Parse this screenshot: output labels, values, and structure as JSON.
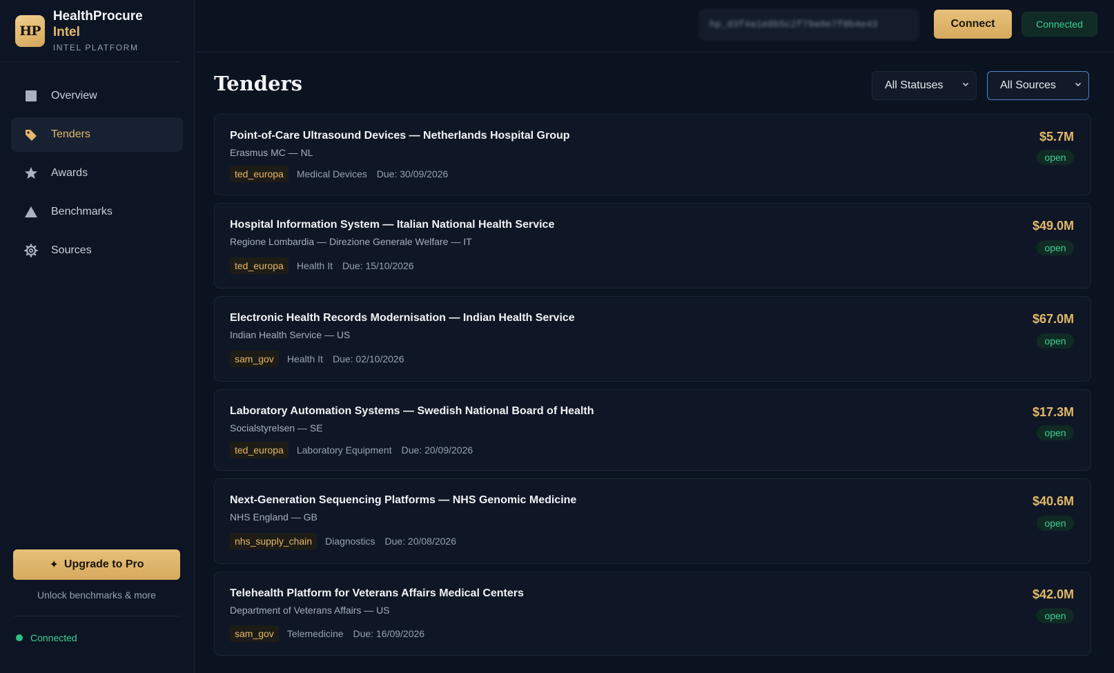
{
  "brand": {
    "logo_text": "HP",
    "name_main": "HealthProcure",
    "name_accent": "Intel",
    "subtitle": "INTEL PLATFORM"
  },
  "sidebar": {
    "items": [
      {
        "label": "Overview",
        "icon": "square-icon",
        "active": false
      },
      {
        "label": "Tenders",
        "icon": "tag-icon",
        "active": true
      },
      {
        "label": "Awards",
        "icon": "star-icon",
        "active": false
      },
      {
        "label": "Benchmarks",
        "icon": "triangle-icon",
        "active": false
      },
      {
        "label": "Sources",
        "icon": "gear-icon",
        "active": false
      }
    ],
    "upgrade_label": "Upgrade to Pro",
    "upgrade_note": "Unlock benchmarks & more",
    "status_text": "Connected"
  },
  "topbar": {
    "api_key_value": "hp_d3f4a1e8b5c2f79a0e7f0b4e43",
    "connect_label": "Connect",
    "connected_label": "Connected"
  },
  "main": {
    "title": "Tenders",
    "status_filter": "All Statuses",
    "source_filter": "All Sources"
  },
  "colors": {
    "accent": "#e3b869",
    "success": "#3fcf95",
    "background": "#0b1220",
    "select_focus": "#4f86c6"
  },
  "tenders": [
    {
      "title": "Point-of-Care Ultrasound Devices — Netherlands Hospital Group",
      "org": "Erasmus MC — NL",
      "source": "ted_europa",
      "category": "Medical Devices",
      "due": "Due: 30/09/2026",
      "value": "$5.7M",
      "status": "open"
    },
    {
      "title": "Hospital Information System — Italian National Health Service",
      "org": "Regione Lombardia — Direzione Generale Welfare — IT",
      "source": "ted_europa",
      "category": "Health It",
      "due": "Due: 15/10/2026",
      "value": "$49.0M",
      "status": "open"
    },
    {
      "title": "Electronic Health Records Modernisation — Indian Health Service",
      "org": "Indian Health Service — US",
      "source": "sam_gov",
      "category": "Health It",
      "due": "Due: 02/10/2026",
      "value": "$67.0M",
      "status": "open"
    },
    {
      "title": "Laboratory Automation Systems — Swedish National Board of Health",
      "org": "Socialstyrelsen — SE",
      "source": "ted_europa",
      "category": "Laboratory Equipment",
      "due": "Due: 20/09/2026",
      "value": "$17.3M",
      "status": "open"
    },
    {
      "title": "Next-Generation Sequencing Platforms — NHS Genomic Medicine",
      "org": "NHS England — GB",
      "source": "nhs_supply_chain",
      "category": "Diagnostics",
      "due": "Due: 20/08/2026",
      "value": "$40.6M",
      "status": "open"
    },
    {
      "title": "Telehealth Platform for Veterans Affairs Medical Centers",
      "org": "Department of Veterans Affairs — US",
      "source": "sam_gov",
      "category": "Telemedicine",
      "due": "Due: 16/09/2026",
      "value": "$42.0M",
      "status": "open"
    }
  ]
}
